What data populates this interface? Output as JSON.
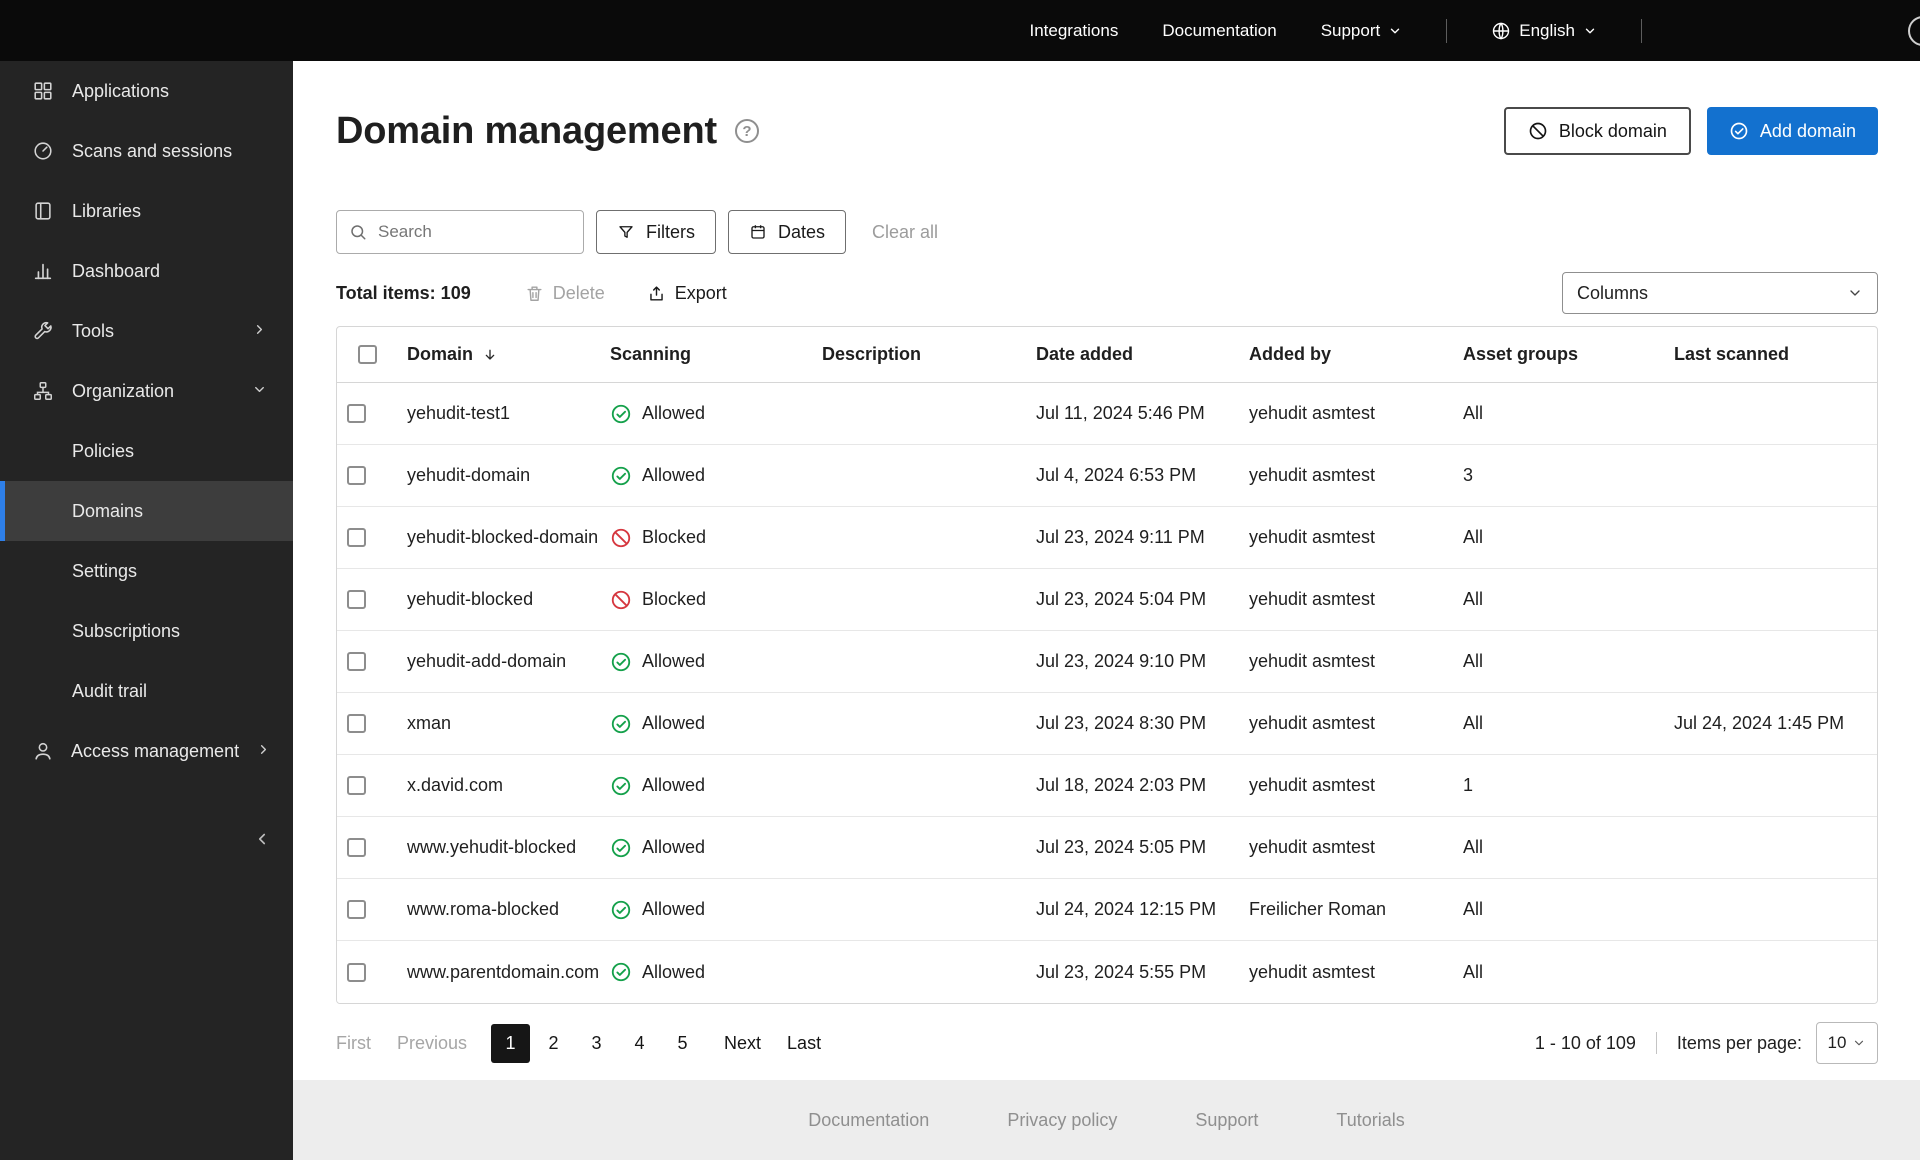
{
  "topbar": {
    "links": [
      "Integrations",
      "Documentation"
    ],
    "support_label": "Support",
    "language_label": "English"
  },
  "sidebar": {
    "items": [
      {
        "label": "Applications"
      },
      {
        "label": "Scans and sessions"
      },
      {
        "label": "Libraries"
      },
      {
        "label": "Dashboard"
      },
      {
        "label": "Tools"
      },
      {
        "label": "Organization"
      }
    ],
    "organization_children": [
      "Policies",
      "Domains",
      "Settings",
      "Subscriptions",
      "Audit trail"
    ],
    "selected_item": "Domains",
    "access_management_label": "Access management"
  },
  "header": {
    "title": "Domain management",
    "block_button": "Block domain",
    "add_button": "Add domain"
  },
  "toolbar": {
    "search_placeholder": "Search",
    "filters": "Filters",
    "dates": "Dates",
    "clear_all": "Clear all",
    "total_items": "Total items: 109",
    "delete": "Delete",
    "export": "Export",
    "columns": "Columns"
  },
  "table": {
    "headers": {
      "domain": "Domain",
      "scanning": "Scanning",
      "description": "Description",
      "date_added": "Date added",
      "added_by": "Added by",
      "asset_groups": "Asset groups",
      "last_scanned": "Last scanned"
    },
    "rows": [
      {
        "domain": "yehudit-test1",
        "scanning": "Allowed",
        "status": "allowed",
        "description": "",
        "date_added": "Jul 11, 2024 5:46 PM",
        "added_by": "yehudit asmtest",
        "asset_groups": "All",
        "last_scanned": ""
      },
      {
        "domain": "yehudit-domain",
        "scanning": "Allowed",
        "status": "allowed",
        "description": "",
        "date_added": "Jul 4, 2024 6:53 PM",
        "added_by": "yehudit asmtest",
        "asset_groups": "3",
        "last_scanned": ""
      },
      {
        "domain": "yehudit-blocked-domain",
        "scanning": "Blocked",
        "status": "blocked",
        "description": "",
        "date_added": "Jul 23, 2024 9:11 PM",
        "added_by": "yehudit asmtest",
        "asset_groups": "All",
        "last_scanned": ""
      },
      {
        "domain": "yehudit-blocked",
        "scanning": "Blocked",
        "status": "blocked",
        "description": "",
        "date_added": "Jul 23, 2024 5:04 PM",
        "added_by": "yehudit asmtest",
        "asset_groups": "All",
        "last_scanned": ""
      },
      {
        "domain": "yehudit-add-domain",
        "scanning": "Allowed",
        "status": "allowed",
        "description": "",
        "date_added": "Jul 23, 2024 9:10 PM",
        "added_by": "yehudit asmtest",
        "asset_groups": "All",
        "last_scanned": ""
      },
      {
        "domain": "xman",
        "scanning": "Allowed",
        "status": "allowed",
        "description": "",
        "date_added": "Jul 23, 2024 8:30 PM",
        "added_by": "yehudit asmtest",
        "asset_groups": "All",
        "last_scanned": "Jul 24, 2024 1:45 PM"
      },
      {
        "domain": "x.david.com",
        "scanning": "Allowed",
        "status": "allowed",
        "description": "",
        "date_added": "Jul 18, 2024 2:03 PM",
        "added_by": "yehudit asmtest",
        "asset_groups": "1",
        "last_scanned": ""
      },
      {
        "domain": "www.yehudit-blocked",
        "scanning": "Allowed",
        "status": "allowed",
        "description": "",
        "date_added": "Jul 23, 2024 5:05 PM",
        "added_by": "yehudit asmtest",
        "asset_groups": "All",
        "last_scanned": ""
      },
      {
        "domain": "www.roma-blocked",
        "scanning": "Allowed",
        "status": "allowed",
        "description": "",
        "date_added": "Jul 24, 2024 12:15 PM",
        "added_by": "Freilicher Roman",
        "asset_groups": "All",
        "last_scanned": ""
      },
      {
        "domain": "www.parentdomain.com",
        "scanning": "Allowed",
        "status": "allowed",
        "description": "",
        "date_added": "Jul 23, 2024 5:55 PM",
        "added_by": "yehudit asmtest",
        "asset_groups": "All",
        "last_scanned": ""
      }
    ]
  },
  "pagination": {
    "first": "First",
    "previous": "Previous",
    "pages": [
      "1",
      "2",
      "3",
      "4",
      "5"
    ],
    "active_page": "1",
    "next": "Next",
    "last": "Last",
    "range": "1 - 10 of 109",
    "items_per_page_label": "Items per page:",
    "items_per_page": "10"
  },
  "footer": {
    "links": [
      "Documentation",
      "Privacy policy",
      "Support",
      "Tutorials"
    ]
  },
  "colors": {
    "accent": "#1371cf",
    "allowed": "#15a14b",
    "blocked": "#d6373f",
    "nav_selected": "#2e7fe8"
  }
}
